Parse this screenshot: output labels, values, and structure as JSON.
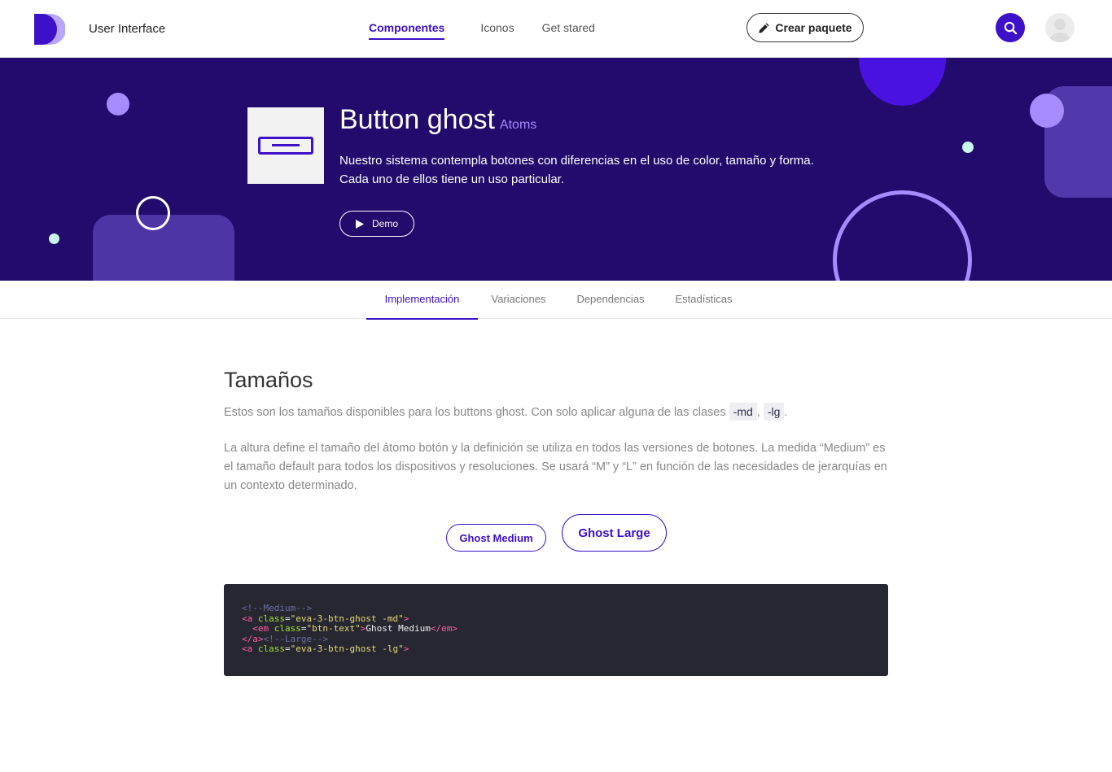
{
  "header": {
    "brand": "User Interface",
    "nav": [
      {
        "label": "Componentes",
        "active": true
      },
      {
        "label": "Iconos",
        "active": false
      },
      {
        "label": "Get stared",
        "active": false
      }
    ],
    "create_button": "Crear paquete",
    "icons": {
      "create": "pencil-icon",
      "search": "search-icon",
      "avatar": "user-avatar-icon",
      "logo": "d-logo"
    }
  },
  "hero": {
    "title": "Button ghost",
    "tag": "Atoms",
    "description_line1": "Nuestro sistema contempla botones con diferencias en el uso de color, tamaño y forma.",
    "description_line2": "Cada uno de ellos tiene un uso particular.",
    "demo_button": "Demo"
  },
  "tabs": [
    {
      "label": "Implementación",
      "active": true
    },
    {
      "label": "Variaciones",
      "active": false
    },
    {
      "label": "Dependencias",
      "active": false
    },
    {
      "label": "Estadísticas",
      "active": false
    }
  ],
  "content": {
    "title": "Tamaños",
    "intro_text": "Estos son los tamaños disponibles para los buttons ghost. Con solo aplicar alguna de las clases",
    "class_md": "-md",
    "comma": ",",
    "class_lg": "-lg",
    "period": ".",
    "paragraph": "La altura define el tamaño del átomo botón y la definición se utiliza en todos las versiones de botones. La medida “Medium” es el tamaño default para todos los dispositivos y resoluciones. Se usará “M” y “L” en función de las necesidades de jerarquías en un contexto determinado.",
    "ghost_medium": "Ghost Medium",
    "ghost_large": "Ghost Large"
  },
  "code": {
    "l1_comment": "<!--Medium-->",
    "l2_open": "<a ",
    "l2_attr": "class",
    "l2_eq": "=",
    "l2_val": "\"eva-3-btn-ghost -md\"",
    "l2_close": ">",
    "l3_open": "  <em ",
    "l3_attr": "class",
    "l3_eq": "=",
    "l3_val": "\"btn-text\"",
    "l3_close": ">",
    "l3_text": "Ghost Medium",
    "l3_end": "</em>",
    "l4_end": "</a>",
    "l4_comment": "<!--Large-->",
    "l5_open": "<a ",
    "l5_attr": "class",
    "l5_eq": "=",
    "l5_val": "\"eva-3-btn-ghost -lg\"",
    "l5_close": ">"
  },
  "colors": {
    "primary": "#3d10c9",
    "hero_bg": "#220b6c",
    "accent_light": "#a58bff",
    "mint": "#c8f5ec"
  }
}
